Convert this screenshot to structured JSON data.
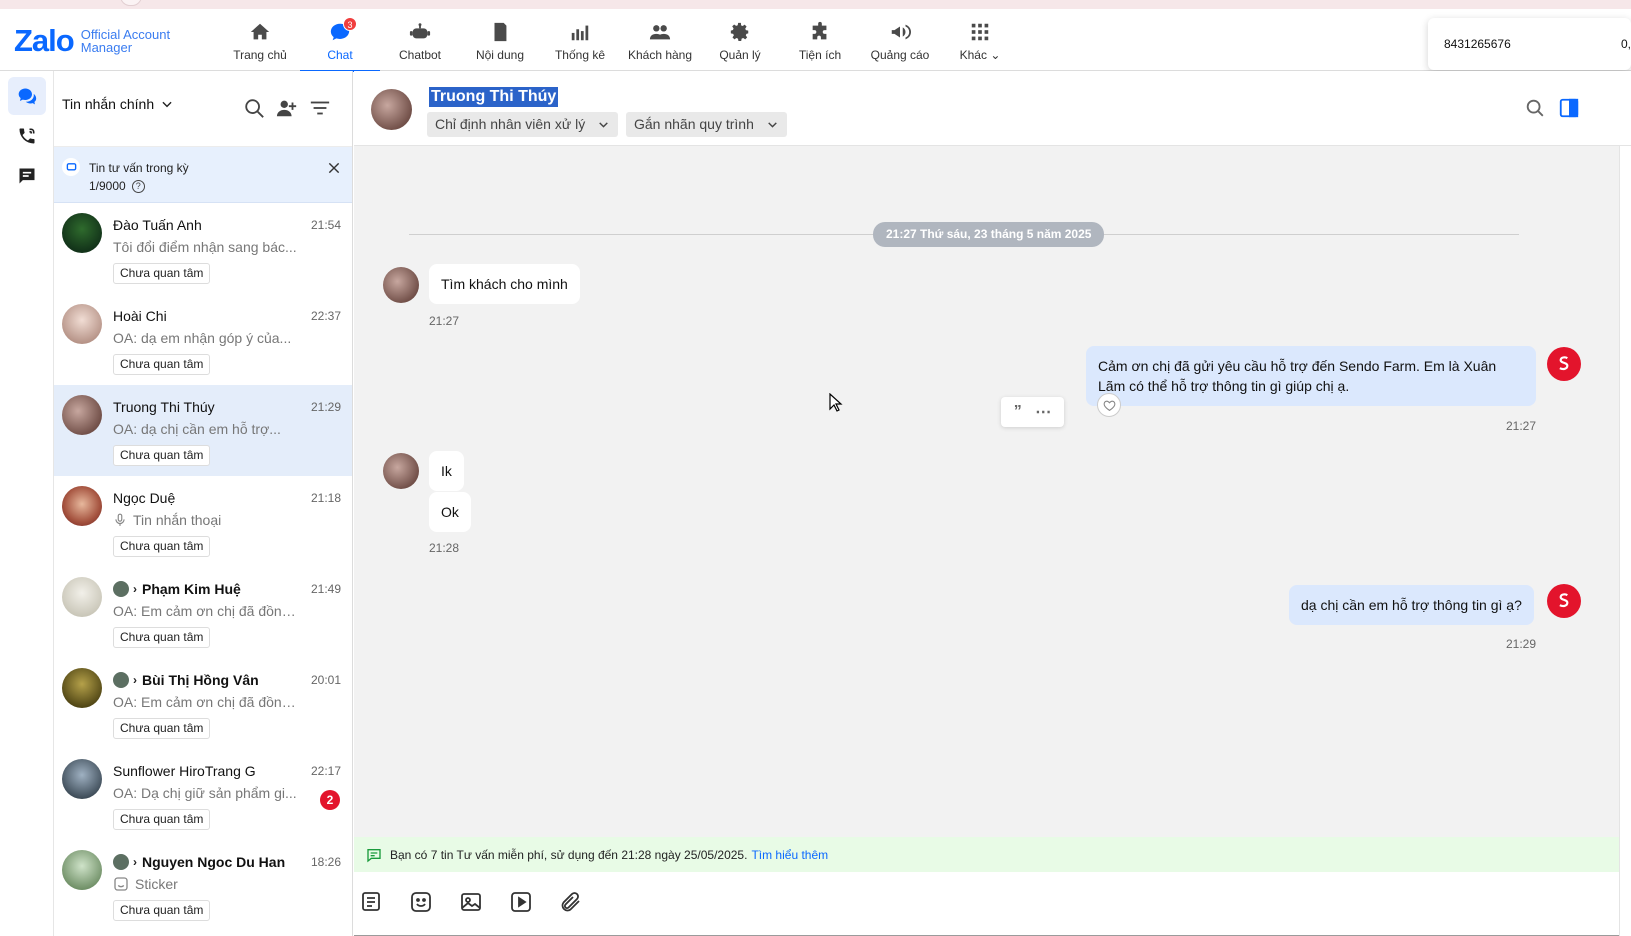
{
  "app": {
    "logo_main": "Zalo",
    "logo_sub_line1": "Official Account",
    "logo_sub_line2": "Manager"
  },
  "nav": [
    {
      "label": "Trang chủ",
      "icon": "home-icon"
    },
    {
      "label": "Chat",
      "icon": "chat-icon",
      "badge": "3",
      "active": true
    },
    {
      "label": "Chatbot",
      "icon": "robot-icon"
    },
    {
      "label": "Nội dung",
      "icon": "document-icon"
    },
    {
      "label": "Thống kê",
      "icon": "bar-chart-icon"
    },
    {
      "label": "Khách hàng",
      "icon": "users-icon"
    },
    {
      "label": "Quản lý",
      "icon": "gear-icon"
    },
    {
      "label": "Tiện ích",
      "icon": "puzzle-icon"
    },
    {
      "label": "Quảng cáo",
      "icon": "megaphone-icon"
    },
    {
      "label": "Khác",
      "icon": "grid-icon"
    }
  ],
  "popup": {
    "phone": "8431265676",
    "extra": "0,"
  },
  "list": {
    "filter_label": "Tin nhắn chính",
    "quota_title": "Tin tư vấn trong kỳ",
    "quota_count": "1/9000",
    "quota_help": "?",
    "conversations": [
      {
        "name": "Đào Tuấn Anh",
        "time": "21:54",
        "preview": "Tôi đổi điểm nhận sang bác...",
        "tag": "Chưa quan tâm"
      },
      {
        "name": "Hoài Chi",
        "time": "22:37",
        "preview": "OA: dạ em nhận góp ý của...",
        "tag": "Chưa quan tâm"
      },
      {
        "name": "Truong Thi Thúy",
        "time": "21:29",
        "preview": "OA: dạ chị cần em hỗ trợ...",
        "tag": "Chưa quan tâm",
        "selected": true
      },
      {
        "name": "Ngọc Duệ",
        "time": "21:18",
        "preview": "Tin nhắn thoại",
        "tag": "Chưa quan tâm"
      },
      {
        "name": "Phạm Kim Huệ",
        "time": "21:49",
        "preview": "OA: Em cảm ơn chị đã đồng...",
        "tag": "Chưa quan tâm"
      },
      {
        "name": "Bùi Thị Hồng Vân",
        "time": "20:01",
        "preview": "OA: Em cảm ơn chị đã đồng...",
        "tag": "Chưa quan tâm"
      },
      {
        "name": "Sunflower HiroTrang G",
        "time": "22:17",
        "preview": "OA: Dạ chị giữ sản phẩm gi...",
        "tag": "Chưa quan tâm",
        "badge": "2"
      },
      {
        "name": "Nguyen Ngoc Du Han",
        "time": "18:26",
        "preview": "Sticker",
        "tag": "Chưa quan tâm"
      }
    ]
  },
  "chat": {
    "title": "Truong Thi Thúy",
    "assign_label": "Chỉ định nhân viên xử lý",
    "label_tag": "Gắn nhãn quy trình",
    "date_separator": "21:27 Thứ sáu, 23 tháng 5 năm 2025",
    "messages": [
      {
        "from": "customer",
        "text": "Tìm khách cho mình",
        "time": "21:27"
      },
      {
        "from": "oa",
        "text": "Cảm ơn chị đã gửi yêu cầu hỗ trợ đến Sendo Farm. Em là Xuân Lãm có thể hỗ trợ thông tin gì giúp chị ạ.",
        "time": "21:27"
      },
      {
        "from": "customer",
        "text": "Ik",
        "time": ""
      },
      {
        "from": "customer",
        "text": "Ok",
        "time": "21:28"
      },
      {
        "from": "oa",
        "text": "dạ chị cần em hỗ trợ thông tin gì ạ?",
        "time": "21:29"
      }
    ],
    "notice": "Bạn có 7 tin Tư vấn miễn phí, sử dụng đến 21:28 ngày 25/05/2025.",
    "notice_link": "Tìm hiểu thêm"
  },
  "colors": {
    "accent": "#0a68ff",
    "badge": "#e3142c",
    "selected_bg": "#e4edfa",
    "notice_bg": "#e8fbe6"
  }
}
